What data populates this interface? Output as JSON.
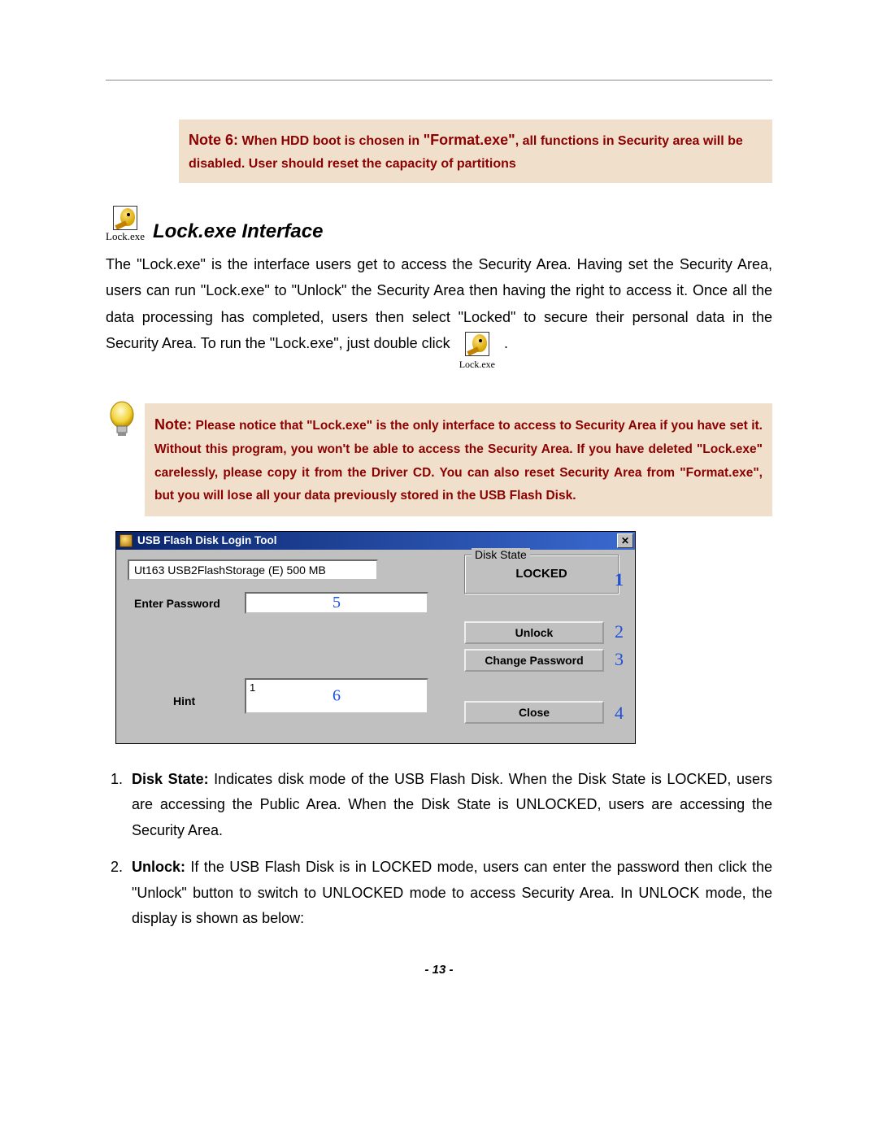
{
  "note6": {
    "label": "Note 6:",
    "text_a": "When HDD boot is chosen in ",
    "format_exe": "\"Format.exe\"",
    "text_b": ", all functions in Security area will be disabled. User should reset the capacity of partitions"
  },
  "icon_caption": "Lock.exe",
  "heading": "Lock.exe Interface",
  "para1_a": "The \"Lock.exe\" is the interface users get to access the Security Area. Having set the Security Area, users can run \"Lock.exe\" to \"Unlock\" the Security Area then having the right to access it. Once all the data processing has completed, users then select \"Locked\" to secure their personal data in the Security Area. To run the \"Lock.exe\", just double click",
  "para1_b": ".",
  "inline_icon_caption": "Lock.exe",
  "note2": {
    "lead": "Note:",
    "body": " Please notice that \"Lock.exe\" is the only interface to access to Security Area if you have set it. Without this program, you won't be able to access the Security Area.  If you have deleted \"Lock.exe\" carelessly, please copy it from the Driver CD. You can also reset Security Area from \"Format.exe\", but you will lose all your data previously stored in the USB Flash Disk."
  },
  "dialog": {
    "title": "USB Flash Disk Login Tool",
    "device_info": "Ut163   USB2FlashStorage (E)  500 MB",
    "enter_password_label": "Enter Password",
    "password_annot": "5",
    "hint_label": "Hint",
    "hint_value": "1",
    "hint_annot": "6",
    "groupbox_title": "Disk State",
    "groupbox_value": "LOCKED",
    "btn_unlock": "Unlock",
    "btn_change": "Change Password",
    "btn_close": "Close",
    "annot1": "1",
    "annot2": "2",
    "annot3": "3",
    "annot4": "4",
    "close_x": "✕"
  },
  "list": {
    "item1_term": "Disk State:",
    "item1_body": " Indicates disk mode of the USB Flash Disk. When the Disk State is LOCKED, users are accessing the Public Area. When the Disk State is UNLOCKED, users are accessing the Security Area.",
    "item2_term": "Unlock:",
    "item2_body": " If the USB Flash Disk is in LOCKED mode, users can enter the password then click the \"Unlock\" button to switch to UNLOCKED mode to access Security Area. In UNLOCK mode, the display is shown as below:"
  },
  "page_number": "- 13 -"
}
